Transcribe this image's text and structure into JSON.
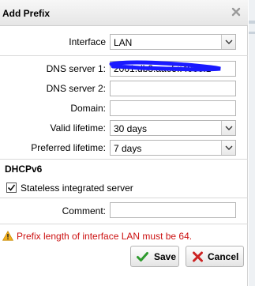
{
  "dialog": {
    "title": "Add Prefix",
    "close_glyph": "✕"
  },
  "form": {
    "interface": {
      "label": "Interface",
      "value": "LAN"
    },
    "dns_server_1": {
      "label": "DNS server 1:",
      "value": "2001:db8:aae5::4000:1"
    },
    "dns_server_2": {
      "label": "DNS server 2:",
      "value": ""
    },
    "domain": {
      "label": "Domain:",
      "value": ""
    },
    "valid_lifetime": {
      "label": "Valid lifetime:",
      "value": "30 days"
    },
    "preferred_lifetime": {
      "label": "Preferred lifetime:",
      "value": "7 days"
    }
  },
  "dhcpv6": {
    "heading": "DHCPv6",
    "stateless_label": "Stateless integrated server",
    "stateless_checked": true
  },
  "comment": {
    "label": "Comment:",
    "value": ""
  },
  "error": {
    "message": "Prefix length of interface LAN must be 64.",
    "color": "#cc1111"
  },
  "buttons": {
    "save": "Save",
    "cancel": "Cancel"
  },
  "icons": {
    "close": "close-icon",
    "dropdown": "chevron-down-icon",
    "warning": "warning-icon",
    "save": "check-icon",
    "cancel": "x-icon"
  }
}
